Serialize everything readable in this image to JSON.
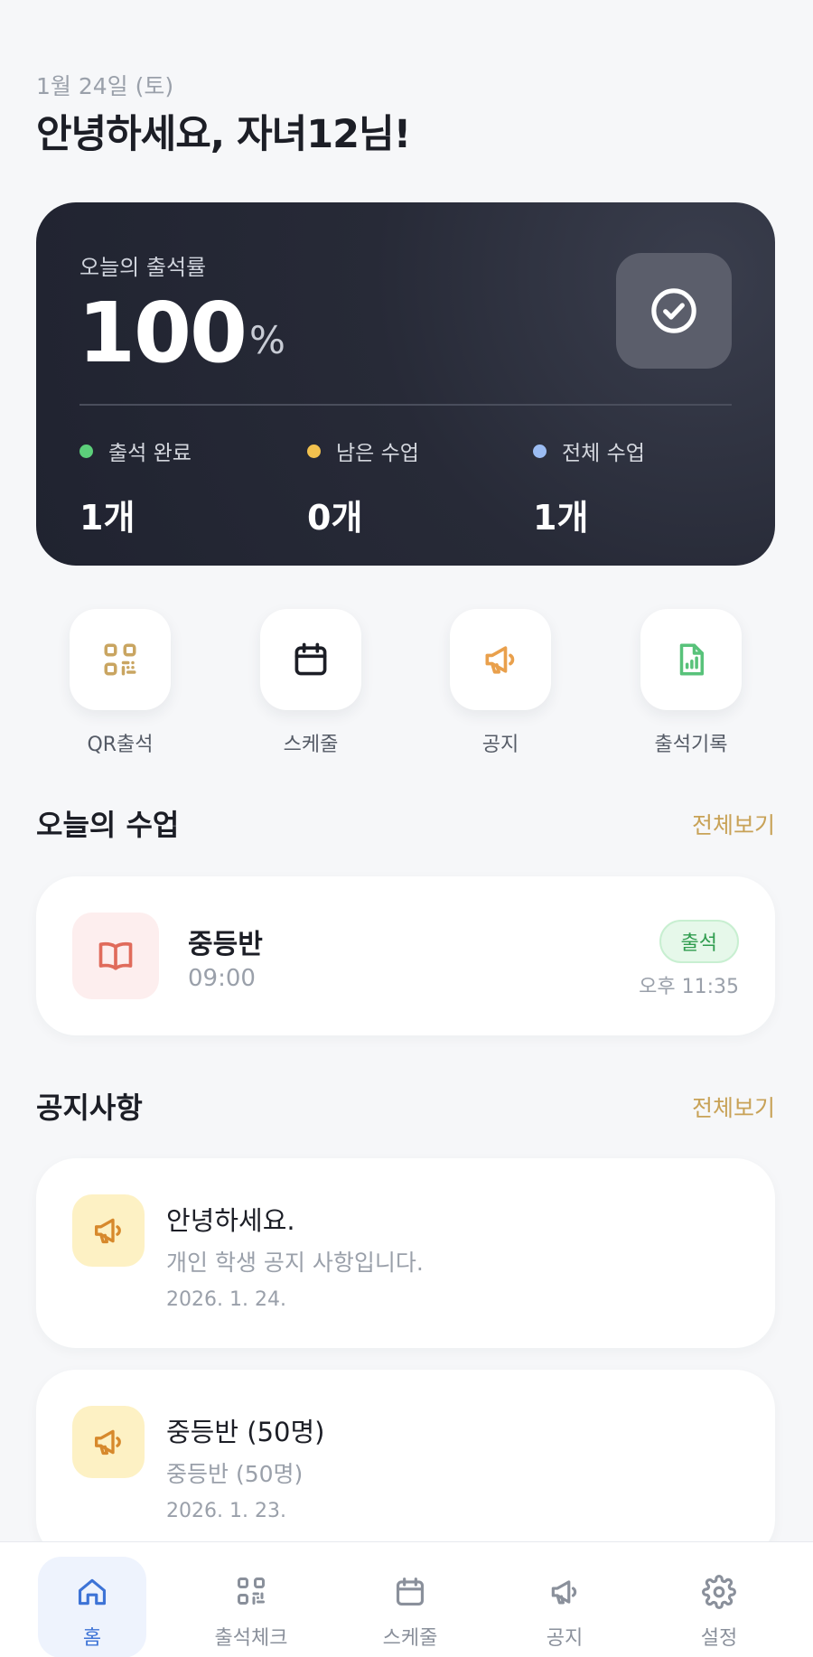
{
  "header": {
    "date": "1월 24일 (토)",
    "greeting": "안녕하세요, 자녀12님!"
  },
  "attendance": {
    "label": "오늘의 출석률",
    "rate": "100",
    "unit": "%",
    "stats": [
      {
        "label": "출석 완료",
        "value": "1개",
        "color": "#5ccf7a"
      },
      {
        "label": "남은 수업",
        "value": "0개",
        "color": "#f2c14e"
      },
      {
        "label": "전체 수업",
        "value": "1개",
        "color": "#9bbcf2"
      }
    ]
  },
  "quick_actions": [
    {
      "label": "QR출석",
      "icon": "qr-code-icon",
      "color": "#c9a561"
    },
    {
      "label": "스케줄",
      "icon": "calendar-icon",
      "color": "#1c1e26"
    },
    {
      "label": "공지",
      "icon": "megaphone-icon",
      "color": "#e9a04c"
    },
    {
      "label": "출석기록",
      "icon": "document-chart-icon",
      "color": "#58c27a"
    }
  ],
  "today_classes": {
    "title": "오늘의 수업",
    "more": "전체보기",
    "items": [
      {
        "name": "중등반",
        "time": "09:00",
        "status": "출석",
        "checked_at": "오후 11:35",
        "icon": "book-icon"
      }
    ]
  },
  "notices": {
    "title": "공지사항",
    "more": "전체보기",
    "items": [
      {
        "title": "안녕하세요.",
        "body": "개인 학생 공지 사항입니다.",
        "date": "2026. 1. 24.",
        "icon": "megaphone-icon"
      },
      {
        "title": "중등반 (50명)",
        "body": "중등반 (50명)",
        "date": "2026. 1. 23.",
        "icon": "megaphone-icon"
      }
    ]
  },
  "bottom_nav": [
    {
      "label": "홈",
      "icon": "home-icon",
      "active": true
    },
    {
      "label": "출석체크",
      "icon": "qr-code-icon",
      "active": false
    },
    {
      "label": "스케줄",
      "icon": "calendar-icon",
      "active": false
    },
    {
      "label": "공지",
      "icon": "megaphone-icon",
      "active": false
    },
    {
      "label": "설정",
      "icon": "gear-icon",
      "active": false
    }
  ]
}
